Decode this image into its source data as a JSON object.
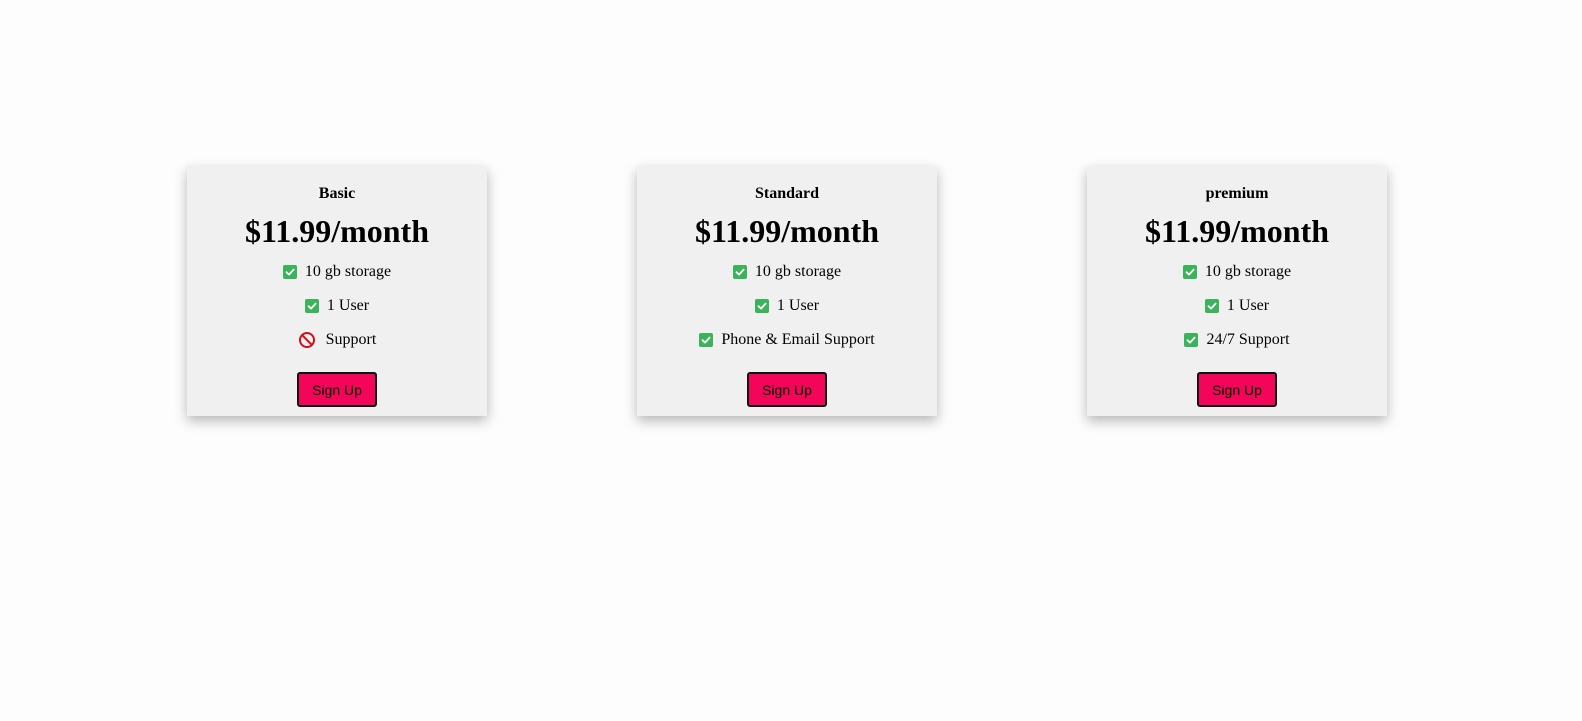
{
  "colors": {
    "check": "#3bb35a",
    "ban": "#d10f16",
    "button": "#f3065a",
    "card": "#f0f0f0"
  },
  "plans": [
    {
      "name": "Basic",
      "price": "$11.99/month",
      "features": [
        {
          "icon": "check-icon",
          "label": "10 gb storage"
        },
        {
          "icon": "check-icon",
          "label": "1 User"
        },
        {
          "icon": "ban-icon",
          "label": "Support"
        }
      ],
      "button": "Sign Up"
    },
    {
      "name": "Standard",
      "price": "$11.99/month",
      "features": [
        {
          "icon": "check-icon",
          "label": "10 gb storage"
        },
        {
          "icon": "check-icon",
          "label": "1 User"
        },
        {
          "icon": "check-icon",
          "label": "Phone & Email Support"
        }
      ],
      "button": "Sign Up"
    },
    {
      "name": "premium",
      "price": "$11.99/month",
      "features": [
        {
          "icon": "check-icon",
          "label": "10 gb storage"
        },
        {
          "icon": "check-icon",
          "label": "1 User"
        },
        {
          "icon": "check-icon",
          "label": "24/7 Support"
        }
      ],
      "button": "Sign Up"
    }
  ]
}
